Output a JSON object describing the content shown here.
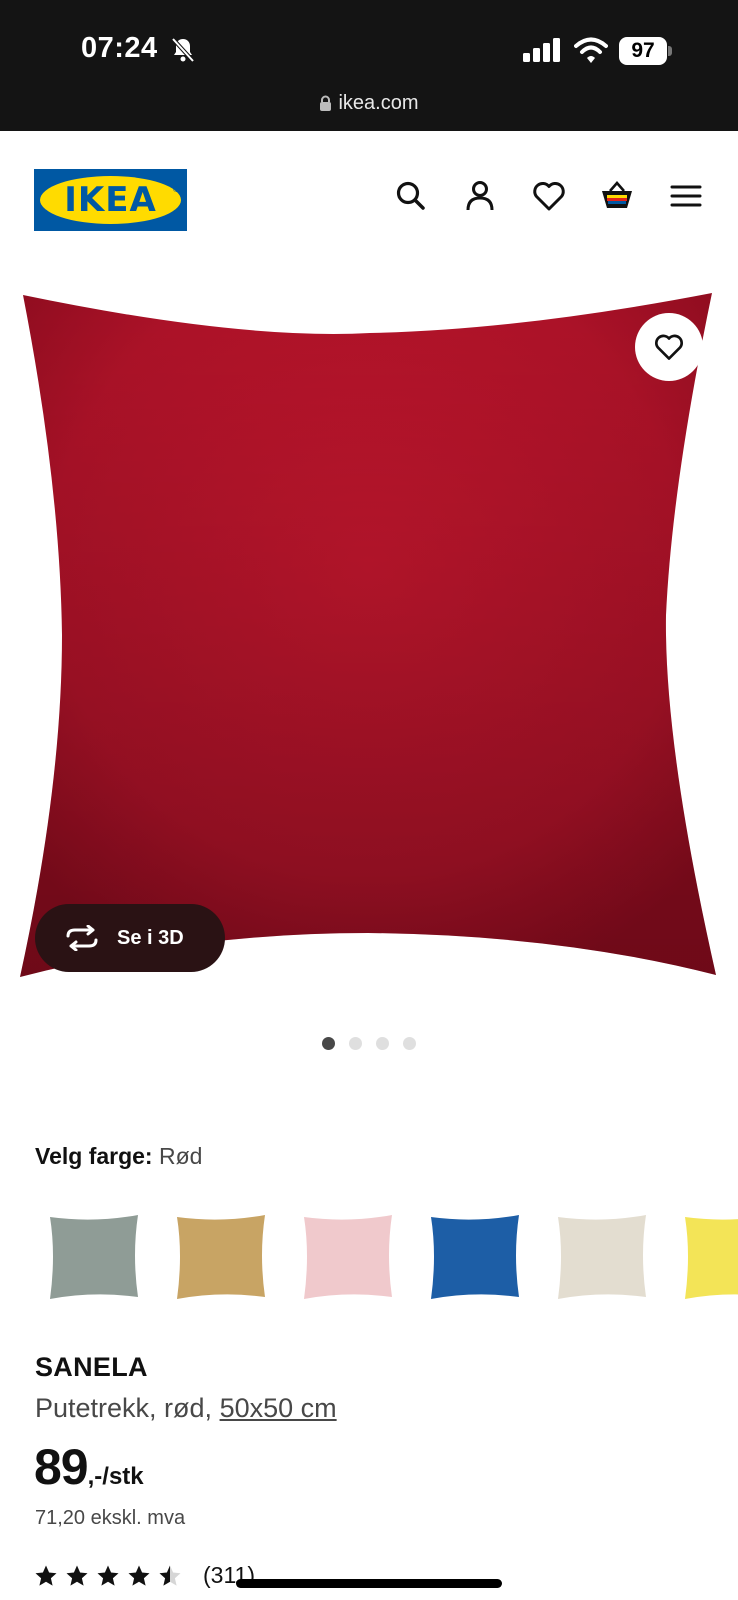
{
  "status_bar": {
    "time": "07:24",
    "battery": "97",
    "url": "ikea.com"
  },
  "header": {
    "logo_text": "IKEA",
    "icons": [
      "search-icon",
      "account-icon",
      "heart-icon",
      "cart-icon",
      "menu-icon"
    ]
  },
  "gallery": {
    "view_3d_label": "Se i 3D",
    "dots_total": 4,
    "active_dot": 1
  },
  "colors": {
    "label": "Velg farge:",
    "selected": "Rød",
    "swatches": [
      "#8f9c96",
      "#c8a464",
      "#f0c9cc",
      "#1d5ea6",
      "#e3ddd0",
      "#f3e457"
    ]
  },
  "product": {
    "name": "SANELA",
    "description": "Putetrekk, rød, ",
    "size": "50x50 cm",
    "price": "89",
    "price_suffix": ",-/stk",
    "price_ex_vat": "71,20 ekskl. mva",
    "rating": 4.5,
    "review_count": "(311)"
  },
  "theme": {
    "accent_blue": "#0058a3",
    "accent_yellow": "#ffdb00",
    "pillow_red": "#b3142a"
  }
}
